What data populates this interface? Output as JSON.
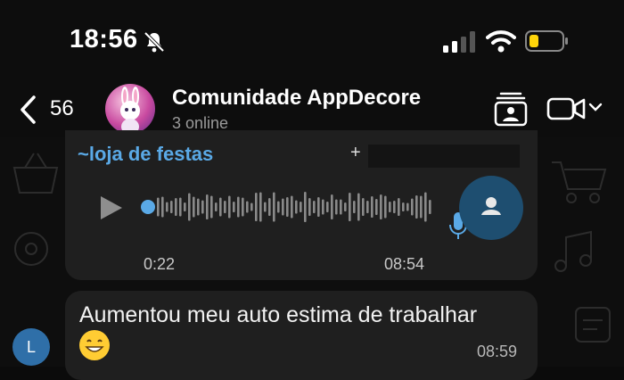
{
  "status_bar": {
    "time": "18:56",
    "battery_color": "#ffd60a"
  },
  "header": {
    "back_count": "56",
    "title": "Comunidade AppDecore",
    "subtitle": "3 online"
  },
  "voice_message": {
    "sender": "~loja de festas",
    "sender_prefix": "+",
    "duration": "0:22",
    "time": "08:54",
    "accent": "#5aa9e6"
  },
  "text_message": {
    "text": "Aumentou meu auto estima de trabalhar",
    "emoji": "😁",
    "time": "08:59"
  },
  "sender_avatar": {
    "initial": "L"
  }
}
